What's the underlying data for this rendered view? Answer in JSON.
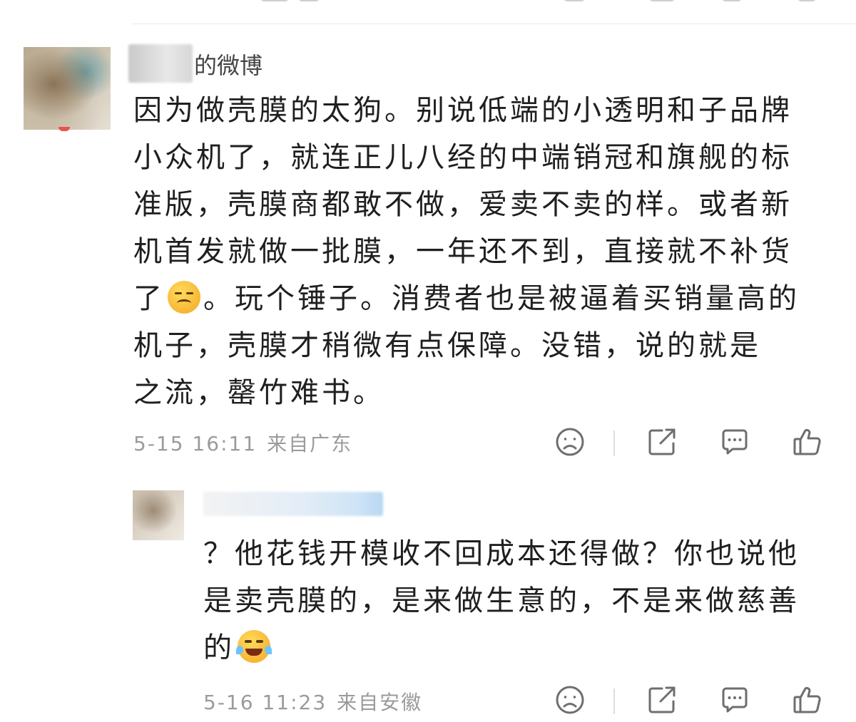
{
  "comments": [
    {
      "username_suffix": "的微博",
      "text_lines": [
        "因为做壳膜的太狗。别说低端的小透明和子品牌",
        "小众机了，就连正儿八经的中端销冠和旗舰的标",
        "准版，壳膜商都敢不做，爱卖不卖的样。或者新",
        "机首发就做一批膜，一年还不到，直接就不补货",
        "了",
        "。玩个锤子。消费者也是被逼着买销量高的",
        "机子，壳膜才稍微有点保障。没错，说的就是",
        "之流，罄竹难书。"
      ],
      "time": "5-15 16:11",
      "location": "来自广东",
      "emoji_inline": "sigh-face-emoji"
    },
    {
      "text_lines": [
        "？他花钱开模收不回成本还得做？你也说他",
        "是卖壳膜的，是来做生意的，不是来做慈善",
        "的"
      ],
      "time": "5-16 11:23",
      "location": "来自安徽",
      "emoji_inline": "laughing-tears-emoji"
    }
  ],
  "icons": {
    "dislike": "sad-face-icon",
    "share": "share-icon",
    "comment": "comment-icon",
    "like": "thumbs-up-icon"
  }
}
